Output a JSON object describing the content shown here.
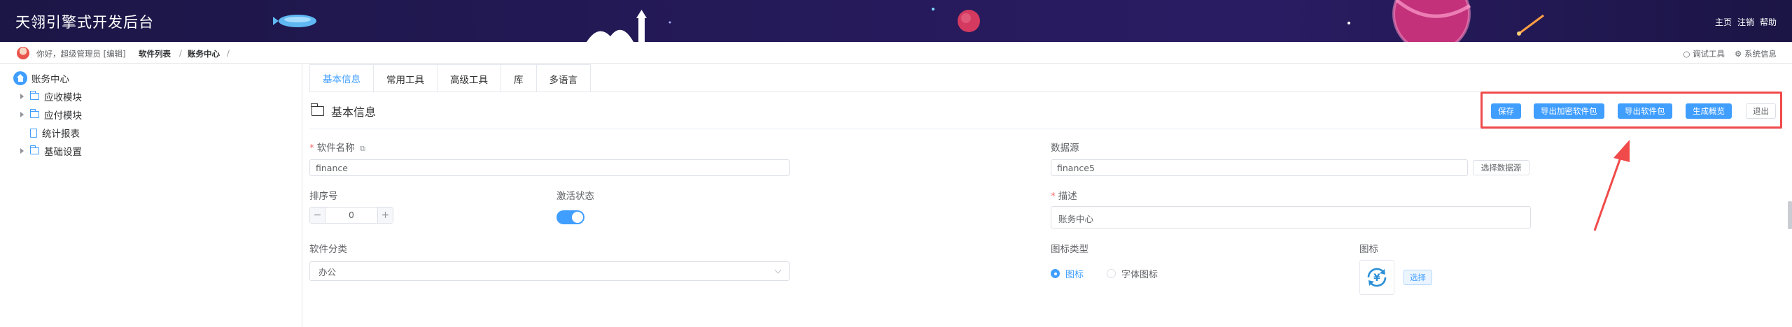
{
  "header": {
    "app_title": "天翎引擎式开发后台",
    "links": [
      "主页",
      "注销",
      "帮助"
    ]
  },
  "breadcrumb": {
    "greeting": "你好，超级管理员 [编辑]",
    "items": [
      "软件列表",
      "/",
      "账务中心",
      "/"
    ],
    "tools": [
      "调试工具",
      "系统信息"
    ]
  },
  "sidebar": {
    "root": "账务中心",
    "items": [
      {
        "label": "应收模块",
        "type": "folder"
      },
      {
        "label": "应付模块",
        "type": "folder"
      },
      {
        "label": "统计报表",
        "type": "doc"
      },
      {
        "label": "基础设置",
        "type": "folder"
      }
    ]
  },
  "tabs": [
    "基本信息",
    "常用工具",
    "高级工具",
    "库",
    "多语言"
  ],
  "section_title": "基本信息",
  "actions": {
    "save": "保存",
    "export_encrypted": "导出加密软件包",
    "export": "导出软件包",
    "generate_overview": "生成概览",
    "exit": "退出"
  },
  "form": {
    "software_name": {
      "label": "软件名称",
      "value": "finance"
    },
    "data_source": {
      "label": "数据源",
      "value": "finance5",
      "button": "选择数据源"
    },
    "sort_order": {
      "label": "排序号",
      "value": "0",
      "minus": "−",
      "plus": "+"
    },
    "active_state": {
      "label": "激活状态",
      "on": true
    },
    "description": {
      "label": "描述",
      "value": "账务中心"
    },
    "category": {
      "label": "软件分类",
      "value": "办公"
    },
    "icon_type": {
      "label": "图标类型",
      "options": [
        "图标",
        "字体图标"
      ],
      "selected": "图标"
    },
    "icon": {
      "label": "图标",
      "button": "选择"
    }
  },
  "colors": {
    "accent": "#409eff",
    "header_bg": "#1c1646",
    "highlight": "#f04a4a",
    "required": "#f56c6c"
  }
}
